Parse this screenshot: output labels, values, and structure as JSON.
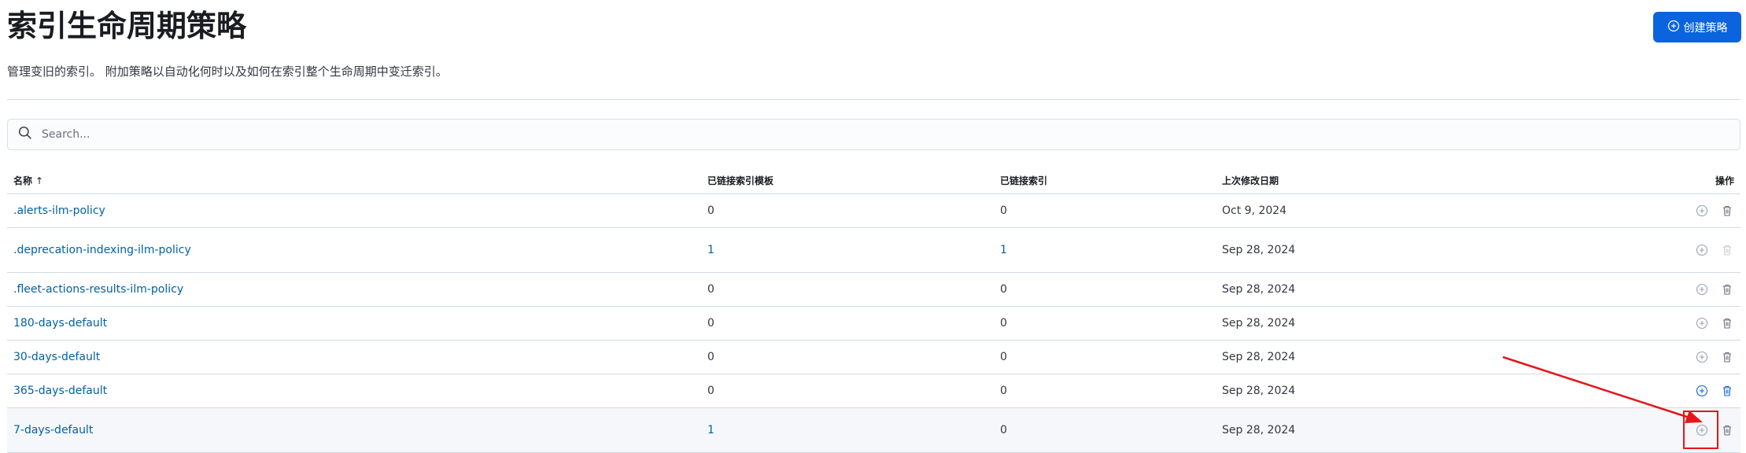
{
  "page": {
    "title": "索引生命周期策略",
    "subtitle": "管理变旧的索引。 附加策略以自动化何时以及如何在索引整个生命周期中变迁索引。",
    "create_button": "创建策略"
  },
  "search": {
    "placeholder": "Search..."
  },
  "table": {
    "headers": {
      "name": "名称",
      "templates": "已链接索引模板",
      "indices": "已链接索引",
      "modified": "上次修改日期",
      "actions": "操作"
    },
    "rows": [
      {
        "name": ".alerts-ilm-policy",
        "templates": "0",
        "indices": "0",
        "modified": "Oct 9, 2024"
      },
      {
        "name": ".deprecation-indexing-ilm-policy",
        "templates": "1",
        "indices": "1",
        "modified": "Sep 28, 2024"
      },
      {
        "name": ".fleet-actions-results-ilm-policy",
        "templates": "0",
        "indices": "0",
        "modified": "Sep 28, 2024"
      },
      {
        "name": "180-days-default",
        "templates": "0",
        "indices": "0",
        "modified": "Sep 28, 2024"
      },
      {
        "name": "30-days-default",
        "templates": "0",
        "indices": "0",
        "modified": "Sep 28, 2024"
      },
      {
        "name": "365-days-default",
        "templates": "0",
        "indices": "0",
        "modified": "Sep 28, 2024"
      },
      {
        "name": "7-days-default",
        "templates": "1",
        "indices": "0",
        "modified": "Sep 28, 2024"
      }
    ]
  },
  "colors": {
    "accent": "#0b64dd",
    "link": "#0061a6",
    "annotation": "#e3161b"
  },
  "icons": {
    "create": "plus-circle-icon",
    "search": "search-icon",
    "add_to_template": "plus-circle-icon",
    "delete": "trash-icon"
  }
}
